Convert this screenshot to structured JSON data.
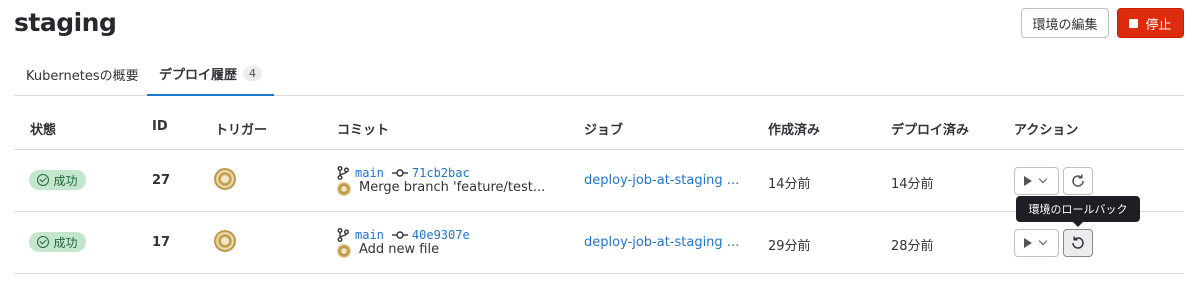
{
  "page": {
    "title": "staging"
  },
  "header_actions": {
    "edit_label": "環境の編集",
    "stop_label": "停止"
  },
  "tabs": [
    {
      "label": "Kubernetesの概要"
    },
    {
      "label": "デプロイ履歴",
      "count": "4"
    }
  ],
  "table": {
    "headers": [
      "状態",
      "ID",
      "トリガー",
      "コミット",
      "ジョブ",
      "作成済み",
      "デプロイ済み",
      "アクション"
    ],
    "rows": [
      {
        "status": "成功",
        "id": "27",
        "branch": "main",
        "sha": "71cb2bac",
        "message": "Merge branch 'feature/test...",
        "job": "deploy-job-at-staging ...",
        "created": "14分前",
        "deployed": "14分前"
      },
      {
        "status": "成功",
        "id": "17",
        "branch": "main",
        "sha": "40e9307e",
        "message": "Add new file",
        "job": "deploy-job-at-staging ...",
        "created": "29分前",
        "deployed": "28分前"
      }
    ]
  },
  "tooltip": {
    "text": "環境のロールバック"
  },
  "colors": {
    "success_bg": "#c3e6cd",
    "success_text": "#24663b",
    "link": "#1f75cb",
    "danger": "#dd2b0e"
  }
}
